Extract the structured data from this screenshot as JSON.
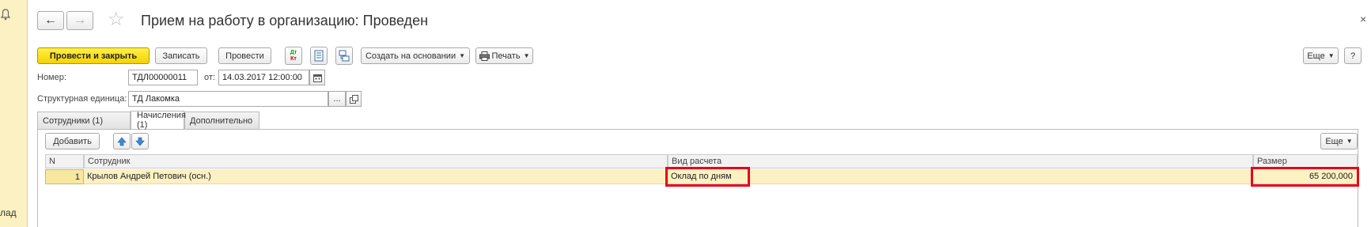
{
  "window": {
    "title": "Прием на работу в организацию: Проведен",
    "close_glyph": "×"
  },
  "nav": {
    "back_glyph": "←",
    "forward_glyph": "→",
    "star_glyph": "☆"
  },
  "toolbar": {
    "post_and_close": "Провести и закрыть",
    "save": "Записать",
    "post": "Провести",
    "dt_kt_top": "Дт",
    "dt_kt_bottom": "Кт",
    "create_based_on": "Создать на основании",
    "print": "Печать",
    "more": "Еще",
    "help": "?"
  },
  "form": {
    "number_label": "Номер:",
    "number_value": "ТДЛ00000011",
    "date_label": "от:",
    "date_value": "14.03.2017 12:00:00",
    "unit_label": "Структурная единица:",
    "unit_value": "ТД Лакомка",
    "select_glyph": "..."
  },
  "tabs": [
    {
      "label": "Сотрудники (1)"
    },
    {
      "label": "Начисления (1)"
    },
    {
      "label": "Дополнительно"
    }
  ],
  "accruals": {
    "add_button": "Добавить",
    "more_button": "Еще",
    "columns": {
      "n": "N",
      "employee": "Сотрудник",
      "calc_type": "Вид расчета",
      "amount": "Размер"
    },
    "rows": [
      {
        "n": "1",
        "employee": "Крылов Андрей Петович (осн.)",
        "calc_type": "Оклад по дням",
        "amount": "65 200,000"
      }
    ]
  },
  "side_panel": {
    "text": "лад"
  },
  "colors": {
    "accent_yellow": "#f5d200",
    "highlight_red": "#e8001c",
    "row_selected": "#fbf1c2"
  }
}
